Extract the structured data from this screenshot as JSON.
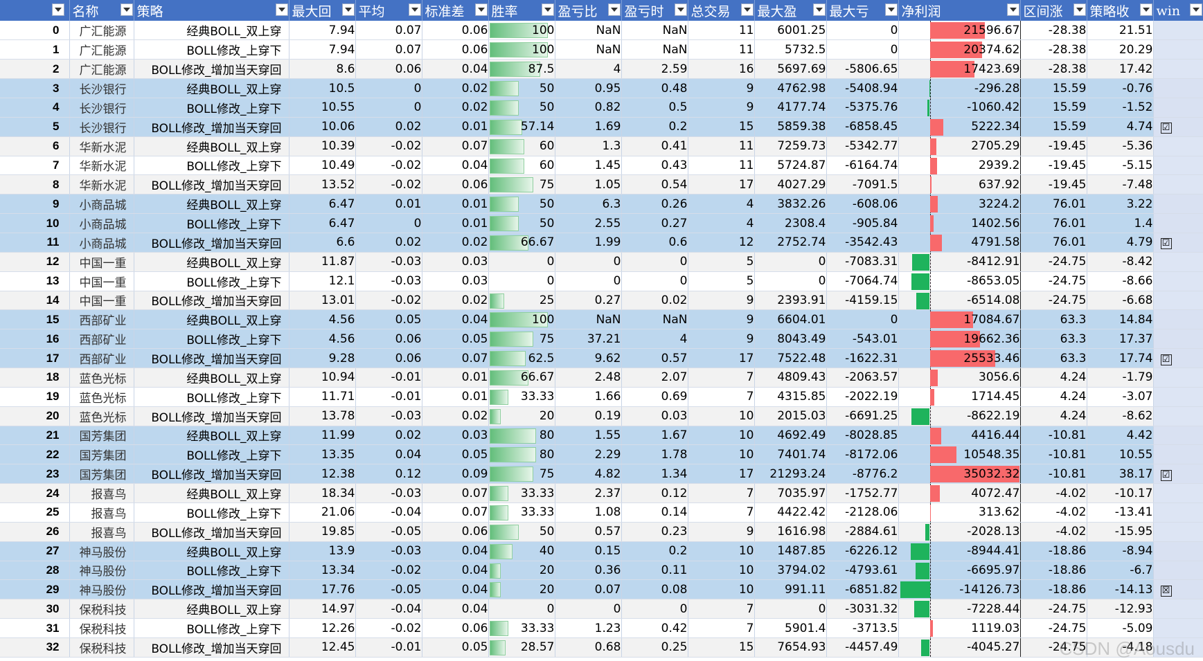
{
  "headers": {
    "idx": "",
    "name": "名称",
    "strategy": "策略",
    "max_drawback": "最大回",
    "avg": "平均",
    "std": "标准差",
    "win_rate": "胜率",
    "pl_ratio": "盈亏比",
    "pl_time": "盈亏时",
    "total_trades": "总交易",
    "max_profit": "最大盈",
    "max_loss": "最大亏",
    "net_profit": "净利润",
    "range_rise": "区间涨",
    "strategy_return": "策略收",
    "win": "win"
  },
  "rows": [
    {
      "idx": "0",
      "name": "广汇能源",
      "strategy": "经典BOLL_双上穿",
      "max_drawback": "7.94",
      "avg": "0.07",
      "std": "0.06",
      "win_rate": "100",
      "win_rate_pct": 100,
      "pl_ratio": "NaN",
      "pl_time": "NaN",
      "total_trades": "11",
      "max_profit": "6001.25",
      "max_loss": "0",
      "net_profit": "21596.67",
      "net_profit_val": 21596.67,
      "range_rise": "-28.38",
      "strategy_return": "21.51",
      "win": "",
      "shade": "r-w"
    },
    {
      "idx": "1",
      "name": "广汇能源",
      "strategy": "BOLL修改_上穿下",
      "max_drawback": "7.94",
      "avg": "0.07",
      "std": "0.06",
      "win_rate": "100",
      "win_rate_pct": 100,
      "pl_ratio": "NaN",
      "pl_time": "NaN",
      "total_trades": "11",
      "max_profit": "5732.5",
      "max_loss": "0",
      "net_profit": "20374.62",
      "net_profit_val": 20374.62,
      "range_rise": "-28.38",
      "strategy_return": "20.29",
      "win": "",
      "shade": "r-w"
    },
    {
      "idx": "2",
      "name": "广汇能源",
      "strategy": "BOLL修改_增加当天穿回",
      "max_drawback": "8.6",
      "avg": "0.06",
      "std": "0.04",
      "win_rate": "87.5",
      "win_rate_pct": 87.5,
      "pl_ratio": "4",
      "pl_time": "2.59",
      "total_trades": "16",
      "max_profit": "5697.69",
      "max_loss": "-5806.65",
      "net_profit": "17423.69",
      "net_profit_val": 17423.69,
      "range_rise": "-28.38",
      "strategy_return": "17.42",
      "win": "",
      "shade": "r-g"
    },
    {
      "idx": "3",
      "name": "长沙银行",
      "strategy": "经典BOLL_双上穿",
      "max_drawback": "10.5",
      "avg": "0",
      "std": "0.02",
      "win_rate": "50",
      "win_rate_pct": 50,
      "pl_ratio": "0.95",
      "pl_time": "0.48",
      "total_trades": "9",
      "max_profit": "4762.98",
      "max_loss": "-5408.94",
      "net_profit": "-296.28",
      "net_profit_val": -296.28,
      "range_rise": "15.59",
      "strategy_return": "-0.76",
      "win": "",
      "shade": "r-b"
    },
    {
      "idx": "4",
      "name": "长沙银行",
      "strategy": "BOLL修改_上穿下",
      "max_drawback": "10.55",
      "avg": "0",
      "std": "0.02",
      "win_rate": "50",
      "win_rate_pct": 50,
      "pl_ratio": "0.82",
      "pl_time": "0.5",
      "total_trades": "9",
      "max_profit": "4177.74",
      "max_loss": "-5375.76",
      "net_profit": "-1060.42",
      "net_profit_val": -1060.42,
      "range_rise": "15.59",
      "strategy_return": "-1.52",
      "win": "",
      "shade": "r-b"
    },
    {
      "idx": "5",
      "name": "长沙银行",
      "strategy": "BOLL修改_增加当天穿回",
      "max_drawback": "10.06",
      "avg": "0.02",
      "std": "0.01",
      "win_rate": "57.14",
      "win_rate_pct": 57.14,
      "pl_ratio": "1.69",
      "pl_time": "0.2",
      "total_trades": "15",
      "max_profit": "5859.38",
      "max_loss": "-6858.45",
      "net_profit": "5222.34",
      "net_profit_val": 5222.34,
      "range_rise": "15.59",
      "strategy_return": "4.74",
      "win": "☑",
      "shade": "r-b"
    },
    {
      "idx": "6",
      "name": "华新水泥",
      "strategy": "经典BOLL_双上穿",
      "max_drawback": "10.39",
      "avg": "-0.02",
      "std": "0.07",
      "win_rate": "60",
      "win_rate_pct": 60,
      "pl_ratio": "1.3",
      "pl_time": "0.41",
      "total_trades": "11",
      "max_profit": "7259.73",
      "max_loss": "-5342.77",
      "net_profit": "2705.29",
      "net_profit_val": 2705.29,
      "range_rise": "-19.45",
      "strategy_return": "-5.36",
      "win": "",
      "shade": "r-g"
    },
    {
      "idx": "7",
      "name": "华新水泥",
      "strategy": "BOLL修改_上穿下",
      "max_drawback": "10.49",
      "avg": "-0.02",
      "std": "0.04",
      "win_rate": "60",
      "win_rate_pct": 60,
      "pl_ratio": "1.45",
      "pl_time": "0.43",
      "total_trades": "11",
      "max_profit": "5724.87",
      "max_loss": "-6164.74",
      "net_profit": "2939.2",
      "net_profit_val": 2939.2,
      "range_rise": "-19.45",
      "strategy_return": "-5.15",
      "win": "",
      "shade": "r-w"
    },
    {
      "idx": "8",
      "name": "华新水泥",
      "strategy": "BOLL修改_增加当天穿回",
      "max_drawback": "13.52",
      "avg": "-0.02",
      "std": "0.06",
      "win_rate": "75",
      "win_rate_pct": 75,
      "pl_ratio": "1.05",
      "pl_time": "0.54",
      "total_trades": "17",
      "max_profit": "4027.29",
      "max_loss": "-7091.5",
      "net_profit": "637.92",
      "net_profit_val": 637.92,
      "range_rise": "-19.45",
      "strategy_return": "-7.48",
      "win": "",
      "shade": "r-g"
    },
    {
      "idx": "9",
      "name": "小商品城",
      "strategy": "经典BOLL_双上穿",
      "max_drawback": "6.47",
      "avg": "0.01",
      "std": "0.01",
      "win_rate": "50",
      "win_rate_pct": 50,
      "pl_ratio": "6.3",
      "pl_time": "0.26",
      "total_trades": "4",
      "max_profit": "3832.26",
      "max_loss": "-608.06",
      "net_profit": "3224.2",
      "net_profit_val": 3224.2,
      "range_rise": "76.01",
      "strategy_return": "3.22",
      "win": "",
      "shade": "r-b"
    },
    {
      "idx": "10",
      "name": "小商品城",
      "strategy": "BOLL修改_上穿下",
      "max_drawback": "6.47",
      "avg": "0",
      "std": "0.01",
      "win_rate": "50",
      "win_rate_pct": 50,
      "pl_ratio": "2.55",
      "pl_time": "0.27",
      "total_trades": "4",
      "max_profit": "2308.4",
      "max_loss": "-905.84",
      "net_profit": "1402.56",
      "net_profit_val": 1402.56,
      "range_rise": "76.01",
      "strategy_return": "1.4",
      "win": "",
      "shade": "r-b"
    },
    {
      "idx": "11",
      "name": "小商品城",
      "strategy": "BOLL修改_增加当天穿回",
      "max_drawback": "6.6",
      "avg": "0.02",
      "std": "0.02",
      "win_rate": "66.67",
      "win_rate_pct": 66.67,
      "pl_ratio": "1.99",
      "pl_time": "0.6",
      "total_trades": "12",
      "max_profit": "2752.74",
      "max_loss": "-3542.43",
      "net_profit": "4791.58",
      "net_profit_val": 4791.58,
      "range_rise": "76.01",
      "strategy_return": "4.79",
      "win": "☑",
      "shade": "r-b"
    },
    {
      "idx": "12",
      "name": "中国一重",
      "strategy": "经典BOLL_双上穿",
      "max_drawback": "11.87",
      "avg": "-0.03",
      "std": "0.03",
      "win_rate": "0",
      "win_rate_pct": 0,
      "pl_ratio": "0",
      "pl_time": "0",
      "total_trades": "5",
      "max_profit": "0",
      "max_loss": "-7083.31",
      "net_profit": "-8412.91",
      "net_profit_val": -8412.91,
      "range_rise": "-24.75",
      "strategy_return": "-8.42",
      "win": "",
      "shade": "r-g"
    },
    {
      "idx": "13",
      "name": "中国一重",
      "strategy": "BOLL修改_上穿下",
      "max_drawback": "12.1",
      "avg": "-0.03",
      "std": "0.03",
      "win_rate": "0",
      "win_rate_pct": 0,
      "pl_ratio": "0",
      "pl_time": "0",
      "total_trades": "5",
      "max_profit": "0",
      "max_loss": "-7064.74",
      "net_profit": "-8653.05",
      "net_profit_val": -8653.05,
      "range_rise": "-24.75",
      "strategy_return": "-8.66",
      "win": "",
      "shade": "r-w"
    },
    {
      "idx": "14",
      "name": "中国一重",
      "strategy": "BOLL修改_增加当天穿回",
      "max_drawback": "13.01",
      "avg": "-0.02",
      "std": "0.02",
      "win_rate": "25",
      "win_rate_pct": 25,
      "pl_ratio": "0.27",
      "pl_time": "0.02",
      "total_trades": "9",
      "max_profit": "2393.91",
      "max_loss": "-4159.15",
      "net_profit": "-6514.08",
      "net_profit_val": -6514.08,
      "range_rise": "-24.75",
      "strategy_return": "-6.68",
      "win": "",
      "shade": "r-g"
    },
    {
      "idx": "15",
      "name": "西部矿业",
      "strategy": "经典BOLL_双上穿",
      "max_drawback": "4.56",
      "avg": "0.05",
      "std": "0.04",
      "win_rate": "100",
      "win_rate_pct": 100,
      "pl_ratio": "NaN",
      "pl_time": "NaN",
      "total_trades": "9",
      "max_profit": "6604.01",
      "max_loss": "0",
      "net_profit": "17084.67",
      "net_profit_val": 17084.67,
      "range_rise": "63.3",
      "strategy_return": "14.84",
      "win": "",
      "shade": "r-b"
    },
    {
      "idx": "16",
      "name": "西部矿业",
      "strategy": "BOLL修改_上穿下",
      "max_drawback": "4.56",
      "avg": "0.06",
      "std": "0.05",
      "win_rate": "75",
      "win_rate_pct": 75,
      "pl_ratio": "37.21",
      "pl_time": "4",
      "total_trades": "9",
      "max_profit": "8043.49",
      "max_loss": "-543.01",
      "net_profit": "19662.36",
      "net_profit_val": 19662.36,
      "range_rise": "63.3",
      "strategy_return": "17.37",
      "win": "",
      "shade": "r-b"
    },
    {
      "idx": "17",
      "name": "西部矿业",
      "strategy": "BOLL修改_增加当天穿回",
      "max_drawback": "9.28",
      "avg": "0.06",
      "std": "0.07",
      "win_rate": "62.5",
      "win_rate_pct": 62.5,
      "pl_ratio": "9.62",
      "pl_time": "0.57",
      "total_trades": "17",
      "max_profit": "7522.48",
      "max_loss": "-1622.31",
      "net_profit": "25533.46",
      "net_profit_val": 25533.46,
      "range_rise": "63.3",
      "strategy_return": "17.74",
      "win": "☑",
      "shade": "r-b"
    },
    {
      "idx": "18",
      "name": "蓝色光标",
      "strategy": "经典BOLL_双上穿",
      "max_drawback": "10.94",
      "avg": "-0.01",
      "std": "0.01",
      "win_rate": "66.67",
      "win_rate_pct": 66.67,
      "pl_ratio": "2.48",
      "pl_time": "2.07",
      "total_trades": "7",
      "max_profit": "4809.43",
      "max_loss": "-2063.57",
      "net_profit": "3056.6",
      "net_profit_val": 3056.6,
      "range_rise": "4.24",
      "strategy_return": "-1.79",
      "win": "",
      "shade": "r-g"
    },
    {
      "idx": "19",
      "name": "蓝色光标",
      "strategy": "BOLL修改_上穿下",
      "max_drawback": "11.71",
      "avg": "-0.01",
      "std": "0.01",
      "win_rate": "33.33",
      "win_rate_pct": 33.33,
      "pl_ratio": "1.66",
      "pl_time": "0.69",
      "total_trades": "7",
      "max_profit": "4315.85",
      "max_loss": "-2022.19",
      "net_profit": "1714.45",
      "net_profit_val": 1714.45,
      "range_rise": "4.24",
      "strategy_return": "-3.07",
      "win": "",
      "shade": "r-w"
    },
    {
      "idx": "20",
      "name": "蓝色光标",
      "strategy": "BOLL修改_增加当天穿回",
      "max_drawback": "13.78",
      "avg": "-0.03",
      "std": "0.02",
      "win_rate": "20",
      "win_rate_pct": 20,
      "pl_ratio": "0.19",
      "pl_time": "0.03",
      "total_trades": "10",
      "max_profit": "2015.03",
      "max_loss": "-6691.25",
      "net_profit": "-8622.19",
      "net_profit_val": -8622.19,
      "range_rise": "4.24",
      "strategy_return": "-8.62",
      "win": "",
      "shade": "r-g"
    },
    {
      "idx": "21",
      "name": "国芳集团",
      "strategy": "经典BOLL_双上穿",
      "max_drawback": "11.99",
      "avg": "0.02",
      "std": "0.03",
      "win_rate": "80",
      "win_rate_pct": 80,
      "pl_ratio": "1.55",
      "pl_time": "1.67",
      "total_trades": "10",
      "max_profit": "4692.49",
      "max_loss": "-8028.85",
      "net_profit": "4416.44",
      "net_profit_val": 4416.44,
      "range_rise": "-10.81",
      "strategy_return": "4.42",
      "win": "",
      "shade": "r-b"
    },
    {
      "idx": "22",
      "name": "国芳集团",
      "strategy": "BOLL修改_上穿下",
      "max_drawback": "13.35",
      "avg": "0.04",
      "std": "0.05",
      "win_rate": "80",
      "win_rate_pct": 80,
      "pl_ratio": "2.29",
      "pl_time": "1.78",
      "total_trades": "10",
      "max_profit": "7401.74",
      "max_loss": "-8172.06",
      "net_profit": "10548.35",
      "net_profit_val": 10548.35,
      "range_rise": "-10.81",
      "strategy_return": "10.55",
      "win": "",
      "shade": "r-b"
    },
    {
      "idx": "23",
      "name": "国芳集团",
      "strategy": "BOLL修改_增加当天穿回",
      "max_drawback": "12.38",
      "avg": "0.12",
      "std": "0.09",
      "win_rate": "75",
      "win_rate_pct": 75,
      "pl_ratio": "4.82",
      "pl_time": "1.34",
      "total_trades": "17",
      "max_profit": "21293.24",
      "max_loss": "-8776.2",
      "net_profit": "35032.32",
      "net_profit_val": 35032.32,
      "range_rise": "-10.81",
      "strategy_return": "38.17",
      "win": "☑",
      "shade": "r-b"
    },
    {
      "idx": "24",
      "name": "报喜鸟",
      "strategy": "经典BOLL_双上穿",
      "max_drawback": "18.34",
      "avg": "-0.03",
      "std": "0.07",
      "win_rate": "33.33",
      "win_rate_pct": 33.33,
      "pl_ratio": "2.37",
      "pl_time": "0.12",
      "total_trades": "7",
      "max_profit": "7035.97",
      "max_loss": "-1752.77",
      "net_profit": "4072.47",
      "net_profit_val": 4072.47,
      "range_rise": "-4.02",
      "strategy_return": "-10.17",
      "win": "",
      "shade": "r-g"
    },
    {
      "idx": "25",
      "name": "报喜鸟",
      "strategy": "BOLL修改_上穿下",
      "max_drawback": "21.06",
      "avg": "-0.04",
      "std": "0.07",
      "win_rate": "33.33",
      "win_rate_pct": 33.33,
      "pl_ratio": "1.08",
      "pl_time": "0.14",
      "total_trades": "7",
      "max_profit": "4422.42",
      "max_loss": "-2128.06",
      "net_profit": "313.62",
      "net_profit_val": 313.62,
      "range_rise": "-4.02",
      "strategy_return": "-13.41",
      "win": "",
      "shade": "r-w"
    },
    {
      "idx": "26",
      "name": "报喜鸟",
      "strategy": "BOLL修改_增加当天穿回",
      "max_drawback": "19.85",
      "avg": "-0.05",
      "std": "0.06",
      "win_rate": "50",
      "win_rate_pct": 50,
      "pl_ratio": "0.57",
      "pl_time": "0.23",
      "total_trades": "9",
      "max_profit": "1616.98",
      "max_loss": "-2884.61",
      "net_profit": "-2028.13",
      "net_profit_val": -2028.13,
      "range_rise": "-4.02",
      "strategy_return": "-15.95",
      "win": "",
      "shade": "r-g"
    },
    {
      "idx": "27",
      "name": "神马股份",
      "strategy": "经典BOLL_双上穿",
      "max_drawback": "13.9",
      "avg": "-0.03",
      "std": "0.04",
      "win_rate": "40",
      "win_rate_pct": 40,
      "pl_ratio": "0.15",
      "pl_time": "0.2",
      "total_trades": "10",
      "max_profit": "1487.85",
      "max_loss": "-6226.12",
      "net_profit": "-8944.41",
      "net_profit_val": -8944.41,
      "range_rise": "-18.86",
      "strategy_return": "-8.94",
      "win": "",
      "shade": "r-b"
    },
    {
      "idx": "28",
      "name": "神马股份",
      "strategy": "BOLL修改_上穿下",
      "max_drawback": "13.34",
      "avg": "-0.02",
      "std": "0.04",
      "win_rate": "20",
      "win_rate_pct": 20,
      "pl_ratio": "0.36",
      "pl_time": "0.11",
      "total_trades": "10",
      "max_profit": "3794.02",
      "max_loss": "-4793.61",
      "net_profit": "-6695.97",
      "net_profit_val": -6695.97,
      "range_rise": "-18.86",
      "strategy_return": "-6.7",
      "win": "",
      "shade": "r-b"
    },
    {
      "idx": "29",
      "name": "神马股份",
      "strategy": "BOLL修改_增加当天穿回",
      "max_drawback": "17.76",
      "avg": "-0.05",
      "std": "0.04",
      "win_rate": "20",
      "win_rate_pct": 20,
      "pl_ratio": "0.07",
      "pl_time": "0.08",
      "total_trades": "10",
      "max_profit": "991.11",
      "max_loss": "-6851.82",
      "net_profit": "-14126.73",
      "net_profit_val": -14126.73,
      "range_rise": "-18.86",
      "strategy_return": "-14.13",
      "win": "☒",
      "shade": "r-b"
    },
    {
      "idx": "30",
      "name": "保税科技",
      "strategy": "经典BOLL_双上穿",
      "max_drawback": "14.97",
      "avg": "-0.04",
      "std": "0.04",
      "win_rate": "0",
      "win_rate_pct": 0,
      "pl_ratio": "0",
      "pl_time": "0",
      "total_trades": "7",
      "max_profit": "0",
      "max_loss": "-3031.32",
      "net_profit": "-7228.44",
      "net_profit_val": -7228.44,
      "range_rise": "-24.75",
      "strategy_return": "-12.93",
      "win": "",
      "shade": "r-g"
    },
    {
      "idx": "31",
      "name": "保税科技",
      "strategy": "BOLL修改_上穿下",
      "max_drawback": "12.26",
      "avg": "-0.02",
      "std": "0.06",
      "win_rate": "33.33",
      "win_rate_pct": 33.33,
      "pl_ratio": "1.23",
      "pl_time": "0.42",
      "total_trades": "7",
      "max_profit": "5901.4",
      "max_loss": "-3713.5",
      "net_profit": "1119.03",
      "net_profit_val": 1119.03,
      "range_rise": "-24.75",
      "strategy_return": "-5.09",
      "win": "",
      "shade": "r-w"
    },
    {
      "idx": "32",
      "name": "保税科技",
      "strategy": "BOLL修改_增加当天穿回",
      "max_drawback": "12.45",
      "avg": "-0.01",
      "std": "0.05",
      "win_rate": "28.57",
      "win_rate_pct": 28.57,
      "pl_ratio": "0.68",
      "pl_time": "0.25",
      "total_trades": "15",
      "max_profit": "7654.93",
      "max_loss": "-4457.49",
      "net_profit": "-4045.27",
      "net_profit_val": -4045.27,
      "range_rise": "-24.75",
      "strategy_return": "-4.18",
      "win": "",
      "shade": "r-g"
    }
  ],
  "watermark": "CSDN @Aousdu",
  "colors": {
    "header_bg": "#4472c4",
    "row_blue": "#bdd7ee",
    "row_gray": "#f2f2f2",
    "bar_green": "#63be7b",
    "pos_bar": "#f8696b",
    "neg_bar": "#1eb35c"
  }
}
